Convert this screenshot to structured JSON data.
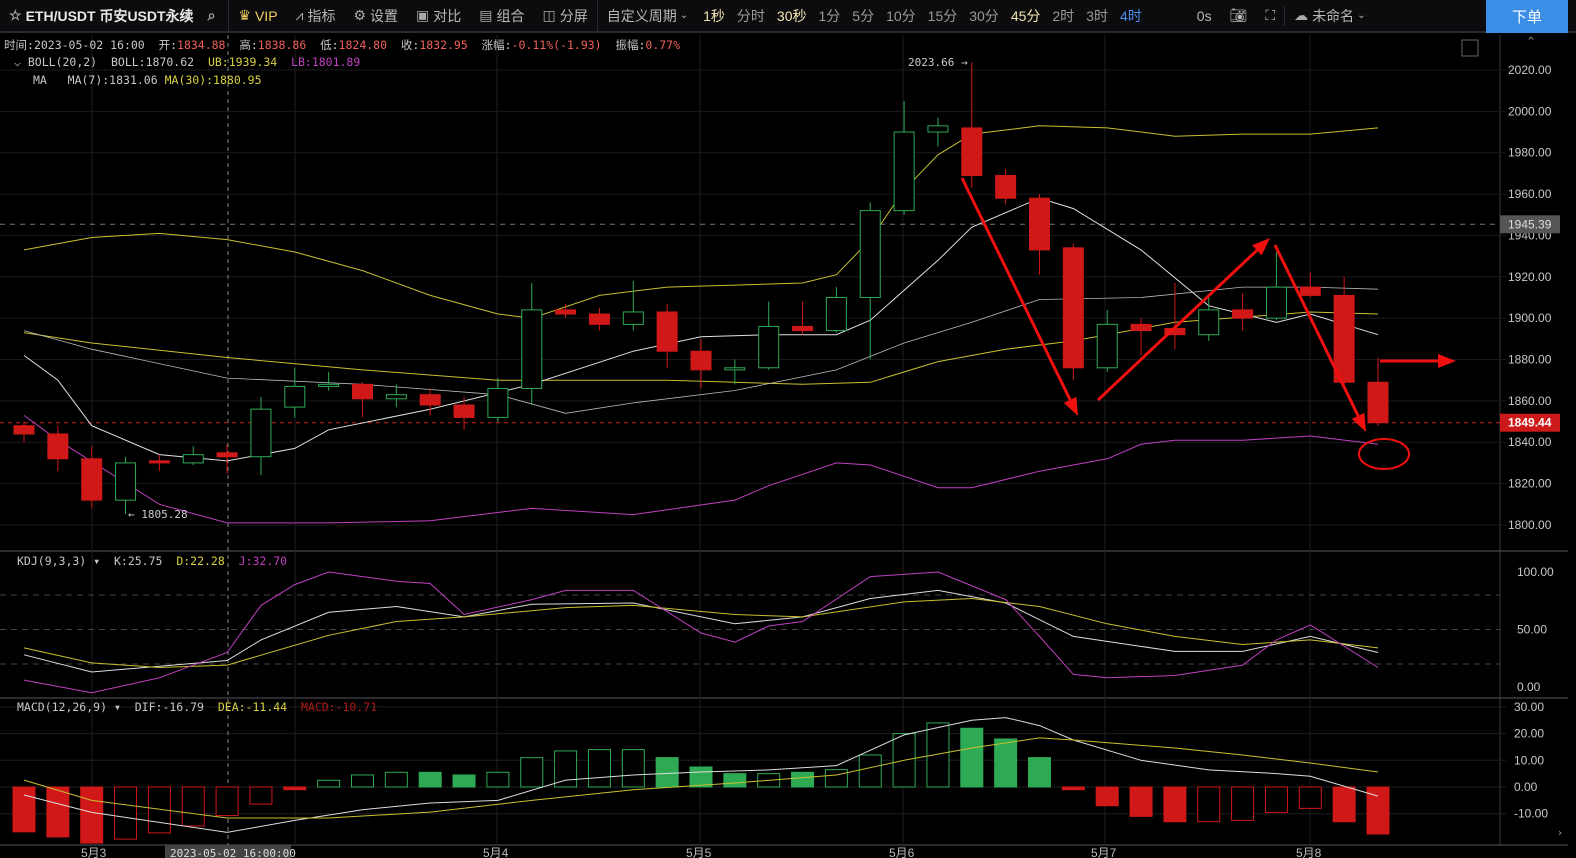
{
  "toolbar": {
    "symbol": "ETH/USDT 币安USDT永续",
    "vip": "VIP",
    "indicators": "指标",
    "settings": "设置",
    "compare": "对比",
    "combo": "组合",
    "split": "分屏",
    "custom_period": "自定义周期",
    "periods": [
      "1秒",
      "分时",
      "30秒",
      "1分",
      "5分",
      "10分",
      "15分",
      "30分",
      "45分",
      "2时",
      "3时",
      "4时"
    ],
    "active_period": "4时",
    "countdown": "0s",
    "layout_name": "未命名",
    "order_button": "下单"
  },
  "info": {
    "time_label": "时间:",
    "time": "2023-05-02 16:00",
    "open_label": "开:",
    "open": "1834.88",
    "high_label": "高:",
    "high": "1838.86",
    "low_label": "低:",
    "low": "1824.80",
    "close_label": "收:",
    "close": "1832.95",
    "change_label": "涨幅:",
    "change": "-0.11%(-1.93)",
    "amp_label": "振幅:",
    "amp": "0.77%"
  },
  "boll": {
    "name": "BOLL(20,2)",
    "mid": "BOLL:1870.62",
    "ub": "UB:1939.34",
    "lb": "LB:1801.89"
  },
  "ma": {
    "name": "MA",
    "ma7": "MA(7):1831.06",
    "ma30": "MA(30):1880.95"
  },
  "kdj": {
    "name": "KDJ(9,3,3)",
    "k": "K:25.75",
    "d": "D:22.28",
    "j": "J:32.70"
  },
  "macd": {
    "name": "MACD(12,26,9)",
    "dif": "DIF:-16.79",
    "dea": "DEA:-11.44",
    "macd": "MACD:-10.71"
  },
  "colors": {
    "up": "#2eaa55",
    "down": "#d01818",
    "ma7": "#e0e0e0",
    "boll": "#c8c030",
    "lb": "#c040c0"
  },
  "chart_data": {
    "type": "candlestick",
    "y_ticks": [
      "2020.00",
      "2000.00",
      "1980.00",
      "1960.00",
      "1940.00",
      "1920.00",
      "1900.00",
      "1880.00",
      "1860.00",
      "1840.00",
      "1820.00",
      "1800.00"
    ],
    "kdj_ticks": [
      "100.00",
      "50.00",
      "0.00"
    ],
    "macd_ticks": [
      "30.00",
      "20.00",
      "10.00",
      "0.00",
      "-10.00"
    ],
    "x_labels": [
      "5月3",
      "5月4",
      "5月5",
      "5月6",
      "5月7",
      "5月8"
    ],
    "crosshair_time": "2023-05-02 16:00:00",
    "last_price": "1849.44",
    "ref_price": "1945.39",
    "max_label": "2023.66 →",
    "min_label": "← 1805.28",
    "candles": [
      [
        1848,
        1850,
        1840,
        1844
      ],
      [
        1844,
        1848,
        1826,
        1832
      ],
      [
        1832,
        1838,
        1808,
        1812
      ],
      [
        1812,
        1833,
        1805.28,
        1830
      ],
      [
        1831,
        1834,
        1826,
        1830
      ],
      [
        1830,
        1838,
        1829,
        1834
      ],
      [
        1834.88,
        1838.86,
        1824.8,
        1832.95
      ],
      [
        1833,
        1862,
        1824,
        1856
      ],
      [
        1857,
        1876,
        1852,
        1867
      ],
      [
        1867,
        1874,
        1865,
        1868
      ],
      [
        1868,
        1869,
        1852,
        1861
      ],
      [
        1861,
        1868,
        1857,
        1863
      ],
      [
        1863,
        1866,
        1853,
        1858
      ],
      [
        1858,
        1862,
        1846,
        1852
      ],
      [
        1852,
        1871,
        1850,
        1866
      ],
      [
        1866,
        1917,
        1858,
        1904
      ],
      [
        1904,
        1907,
        1900,
        1902
      ],
      [
        1902,
        1905,
        1894,
        1897
      ],
      [
        1897,
        1918,
        1894,
        1903
      ],
      [
        1903,
        1907,
        1876,
        1884
      ],
      [
        1884,
        1890,
        1866,
        1875
      ],
      [
        1875,
        1880,
        1868,
        1876
      ],
      [
        1876,
        1908,
        1875,
        1896
      ],
      [
        1896,
        1908,
        1892,
        1894
      ],
      [
        1894,
        1915,
        1893,
        1910
      ],
      [
        1910,
        1956,
        1880,
        1952
      ],
      [
        1952,
        2005,
        1950,
        1990
      ],
      [
        1990,
        1997,
        1983,
        1993
      ],
      [
        1992,
        2023.66,
        1963,
        1969
      ],
      [
        1969,
        1972,
        1955,
        1958
      ],
      [
        1958,
        1960,
        1921,
        1933
      ],
      [
        1934,
        1936,
        1870,
        1876
      ],
      [
        1876,
        1904,
        1874,
        1897
      ],
      [
        1897,
        1900,
        1882,
        1894
      ],
      [
        1895,
        1917,
        1885,
        1892
      ],
      [
        1892,
        1910,
        1889,
        1904
      ],
      [
        1904,
        1912,
        1894,
        1900
      ],
      [
        1900,
        1932,
        1899,
        1915
      ],
      [
        1915,
        1922,
        1910,
        1911
      ],
      [
        1911,
        1920,
        1868,
        1869
      ],
      [
        1869,
        1881,
        1848,
        1849.44
      ]
    ],
    "ub": [
      [
        0,
        1933
      ],
      [
        2,
        1939
      ],
      [
        4,
        1941
      ],
      [
        6,
        1938
      ],
      [
        8,
        1932
      ],
      [
        10,
        1923
      ],
      [
        12,
        1911
      ],
      [
        14,
        1902
      ],
      [
        15,
        1900
      ],
      [
        17,
        1911
      ],
      [
        19,
        1915
      ],
      [
        21,
        1916
      ],
      [
        23,
        1917
      ],
      [
        24,
        1921
      ],
      [
        25,
        1938
      ],
      [
        26,
        1962
      ],
      [
        27,
        1979
      ],
      [
        28,
        1989
      ],
      [
        29,
        1991
      ],
      [
        30,
        1993
      ],
      [
        32,
        1992
      ],
      [
        34,
        1988
      ],
      [
        36,
        1989
      ],
      [
        38,
        1989
      ],
      [
        40,
        1992
      ]
    ],
    "mid": [
      [
        0,
        1893
      ],
      [
        2,
        1888
      ],
      [
        6,
        1881
      ],
      [
        10,
        1875
      ],
      [
        14,
        1870
      ],
      [
        19,
        1870
      ],
      [
        23,
        1868
      ],
      [
        25,
        1869
      ],
      [
        27,
        1879
      ],
      [
        29,
        1885
      ],
      [
        31,
        1889
      ],
      [
        34,
        1898
      ],
      [
        38,
        1903
      ],
      [
        40,
        1902
      ]
    ],
    "lb": [
      [
        0,
        1853
      ],
      [
        1,
        1841
      ],
      [
        4,
        1810
      ],
      [
        6,
        1801
      ],
      [
        9,
        1801
      ],
      [
        12,
        1802
      ],
      [
        15,
        1808
      ],
      [
        18,
        1805
      ],
      [
        21,
        1812
      ],
      [
        22,
        1819
      ],
      [
        24,
        1830
      ],
      [
        25,
        1829
      ],
      [
        27,
        1818
      ],
      [
        28,
        1818
      ],
      [
        30,
        1826
      ],
      [
        32,
        1832
      ],
      [
        33,
        1839
      ],
      [
        34,
        1841
      ],
      [
        36,
        1841
      ],
      [
        38,
        1843
      ],
      [
        40,
        1839
      ]
    ],
    "ma7": [
      [
        0,
        1882
      ],
      [
        1,
        1870
      ],
      [
        2,
        1848
      ],
      [
        4,
        1834
      ],
      [
        6,
        1831
      ],
      [
        8,
        1837
      ],
      [
        9,
        1846
      ],
      [
        12,
        1856
      ],
      [
        15,
        1868
      ],
      [
        18,
        1884
      ],
      [
        20,
        1891
      ],
      [
        22,
        1892
      ],
      [
        24,
        1892
      ],
      [
        25,
        1899
      ],
      [
        27,
        1928
      ],
      [
        28,
        1944
      ],
      [
        30,
        1958
      ],
      [
        31,
        1953
      ],
      [
        33,
        1933
      ],
      [
        35,
        1906
      ],
      [
        37,
        1898
      ],
      [
        38,
        1902
      ],
      [
        40,
        1892
      ]
    ],
    "ma30": [
      [
        0,
        1894
      ],
      [
        2,
        1885
      ],
      [
        6,
        1871
      ],
      [
        10,
        1868
      ],
      [
        14,
        1863
      ],
      [
        16,
        1854
      ],
      [
        18,
        1859
      ],
      [
        21,
        1865
      ],
      [
        24,
        1875
      ],
      [
        26,
        1888
      ],
      [
        28,
        1898
      ],
      [
        30,
        1909
      ],
      [
        33,
        1910
      ],
      [
        36,
        1915
      ],
      [
        38,
        1915
      ],
      [
        40,
        1914
      ]
    ],
    "k": [
      [
        0,
        28
      ],
      [
        2,
        13
      ],
      [
        6,
        23
      ],
      [
        7,
        41
      ],
      [
        9,
        65
      ],
      [
        11,
        70
      ],
      [
        13,
        61
      ],
      [
        15,
        72
      ],
      [
        18,
        73
      ],
      [
        21,
        55
      ],
      [
        23,
        61
      ],
      [
        25,
        77
      ],
      [
        27,
        84
      ],
      [
        29,
        73
      ],
      [
        31,
        44
      ],
      [
        34,
        31
      ],
      [
        36,
        31
      ],
      [
        38,
        44
      ],
      [
        40,
        30
      ]
    ],
    "d": [
      [
        0,
        34
      ],
      [
        2,
        21
      ],
      [
        4,
        17
      ],
      [
        6,
        19
      ],
      [
        9,
        45
      ],
      [
        11,
        57
      ],
      [
        13,
        61
      ],
      [
        16,
        69
      ],
      [
        18,
        71
      ],
      [
        21,
        63
      ],
      [
        23,
        61
      ],
      [
        26,
        74
      ],
      [
        28,
        77
      ],
      [
        30,
        70
      ],
      [
        32,
        55
      ],
      [
        34,
        44
      ],
      [
        36,
        37
      ],
      [
        38,
        41
      ],
      [
        40,
        34
      ]
    ],
    "j": [
      [
        0,
        6
      ],
      [
        2,
        -5
      ],
      [
        4,
        8
      ],
      [
        6,
        30
      ],
      [
        7,
        71
      ],
      [
        8,
        89
      ],
      [
        9,
        100
      ],
      [
        11,
        92
      ],
      [
        12,
        90
      ],
      [
        13,
        63
      ],
      [
        15,
        76
      ],
      [
        16,
        84
      ],
      [
        18,
        84
      ],
      [
        20,
        47
      ],
      [
        21,
        39
      ],
      [
        22,
        53
      ],
      [
        23,
        57
      ],
      [
        25,
        96
      ],
      [
        27,
        100
      ],
      [
        29,
        76
      ],
      [
        30,
        44
      ],
      [
        31,
        11
      ],
      [
        32,
        8
      ],
      [
        34,
        10
      ],
      [
        36,
        19
      ],
      [
        37,
        41
      ],
      [
        38,
        54
      ],
      [
        40,
        17
      ]
    ],
    "hist": [
      [
        -16.8,
        1
      ],
      [
        -18.7,
        1
      ],
      [
        -21,
        1
      ],
      [
        -19.5,
        0
      ],
      [
        -17.2,
        0
      ],
      [
        -14.6,
        0
      ],
      [
        -10.7,
        0
      ],
      [
        -6.4,
        0
      ],
      [
        -1,
        1
      ],
      [
        2.5,
        0
      ],
      [
        4.5,
        0
      ],
      [
        5.5,
        0
      ],
      [
        5.5,
        1
      ],
      [
        4.5,
        1
      ],
      [
        5.5,
        0
      ],
      [
        11,
        0
      ],
      [
        13.5,
        0
      ],
      [
        14,
        0
      ],
      [
        14,
        0
      ],
      [
        11,
        1
      ],
      [
        7.5,
        1
      ],
      [
        5,
        1
      ],
      [
        5,
        0
      ],
      [
        5.5,
        1
      ],
      [
        6.5,
        0
      ],
      [
        12,
        0
      ],
      [
        20,
        0
      ],
      [
        24,
        0
      ],
      [
        22,
        1
      ],
      [
        18,
        1
      ],
      [
        11,
        1
      ],
      [
        -1,
        1
      ],
      [
        -7,
        1
      ],
      [
        -11,
        1
      ],
      [
        -13,
        1
      ],
      [
        -13,
        0
      ],
      [
        -12.5,
        0
      ],
      [
        -9.5,
        0
      ],
      [
        -8,
        0
      ],
      [
        -13,
        1
      ],
      [
        -17.6,
        1
      ]
    ],
    "dif": [
      [
        0,
        -3
      ],
      [
        2,
        -9.5
      ],
      [
        6,
        -17
      ],
      [
        8,
        -12.5
      ],
      [
        10,
        -8.5
      ],
      [
        12,
        -6
      ],
      [
        14,
        -5
      ],
      [
        16,
        2.6
      ],
      [
        18,
        4.5
      ],
      [
        20,
        5.6
      ],
      [
        22,
        6.4
      ],
      [
        24,
        8
      ],
      [
        26,
        19.5
      ],
      [
        28,
        25
      ],
      [
        29,
        26
      ],
      [
        30,
        23
      ],
      [
        31,
        17.6
      ],
      [
        33,
        10
      ],
      [
        35,
        6.4
      ],
      [
        37,
        5
      ],
      [
        38,
        4
      ],
      [
        40,
        -3.4
      ]
    ],
    "dea": [
      [
        0,
        2.6
      ],
      [
        2,
        -5
      ],
      [
        6,
        -11.6
      ],
      [
        9,
        -11.6
      ],
      [
        12,
        -9.4
      ],
      [
        15,
        -5
      ],
      [
        18,
        -1
      ],
      [
        21,
        1.5
      ],
      [
        24,
        4.5
      ],
      [
        26,
        10
      ],
      [
        28,
        14.6
      ],
      [
        30,
        18.4
      ],
      [
        31,
        17.6
      ],
      [
        34,
        14.6
      ],
      [
        36,
        12
      ],
      [
        38,
        9
      ],
      [
        40,
        5.6
      ]
    ]
  }
}
